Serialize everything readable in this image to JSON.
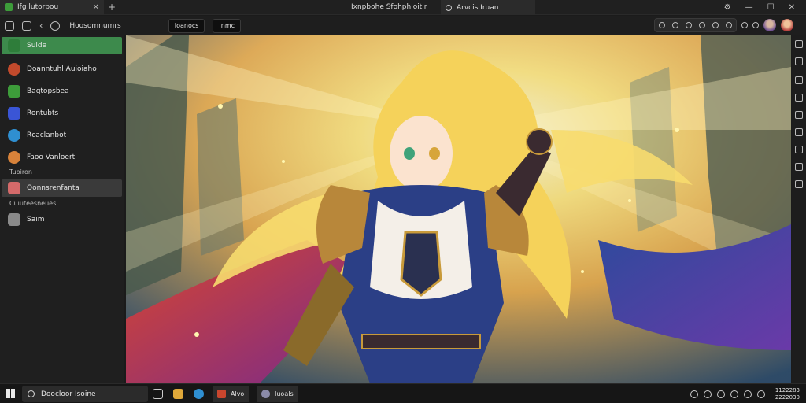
{
  "window": {
    "tab1_title": "Ifg lutorbou",
    "tab_add": "+",
    "center_title": "Ixnpbohe Sfohphloitir",
    "tab2_title": "Arvcis Iruan",
    "close_glyph": "✕"
  },
  "toolbar": {
    "site_label": "Hoosomnumrs",
    "button1_label": "Ioanocs",
    "button2_label": "Inmc"
  },
  "sidebar": {
    "items": [
      {
        "label": "Suide",
        "icon": "controller-icon",
        "color": "#2e7d3a"
      },
      {
        "label": "Doanntuhl Auioiaho",
        "icon": "globe-icon",
        "color": "#c24a2c"
      },
      {
        "label": "Baqtopsbea",
        "icon": "paint-icon",
        "color": "#3d9c3a"
      },
      {
        "label": "Rontubts",
        "icon": "app-icon",
        "color": "#3a55d6"
      },
      {
        "label": "Rcaclanbot",
        "icon": "planet-icon",
        "color": "#2f8fd1"
      },
      {
        "label": "Faoo Vanloert",
        "icon": "avatar-icon",
        "color": "#d7823a"
      },
      {
        "label": "Oonnsrenfanta",
        "icon": "tag-icon",
        "color": "#d46a6a"
      },
      {
        "label": "Saim",
        "icon": "square-icon",
        "color": "#8a8a8a"
      }
    ],
    "sub1": "Tuoiron",
    "sub2": "Cuiuteesneues"
  },
  "taskbar": {
    "search_placeholder": "Doocloor Isoine",
    "app1_label": "Alvo",
    "app2_label": "Iuoals",
    "clock_time": "1122283",
    "clock_date": "2222030"
  },
  "colors": {
    "accent": "#3d8a4c",
    "background": "#1b1b1b",
    "sidebar": "#1f1f1f"
  }
}
